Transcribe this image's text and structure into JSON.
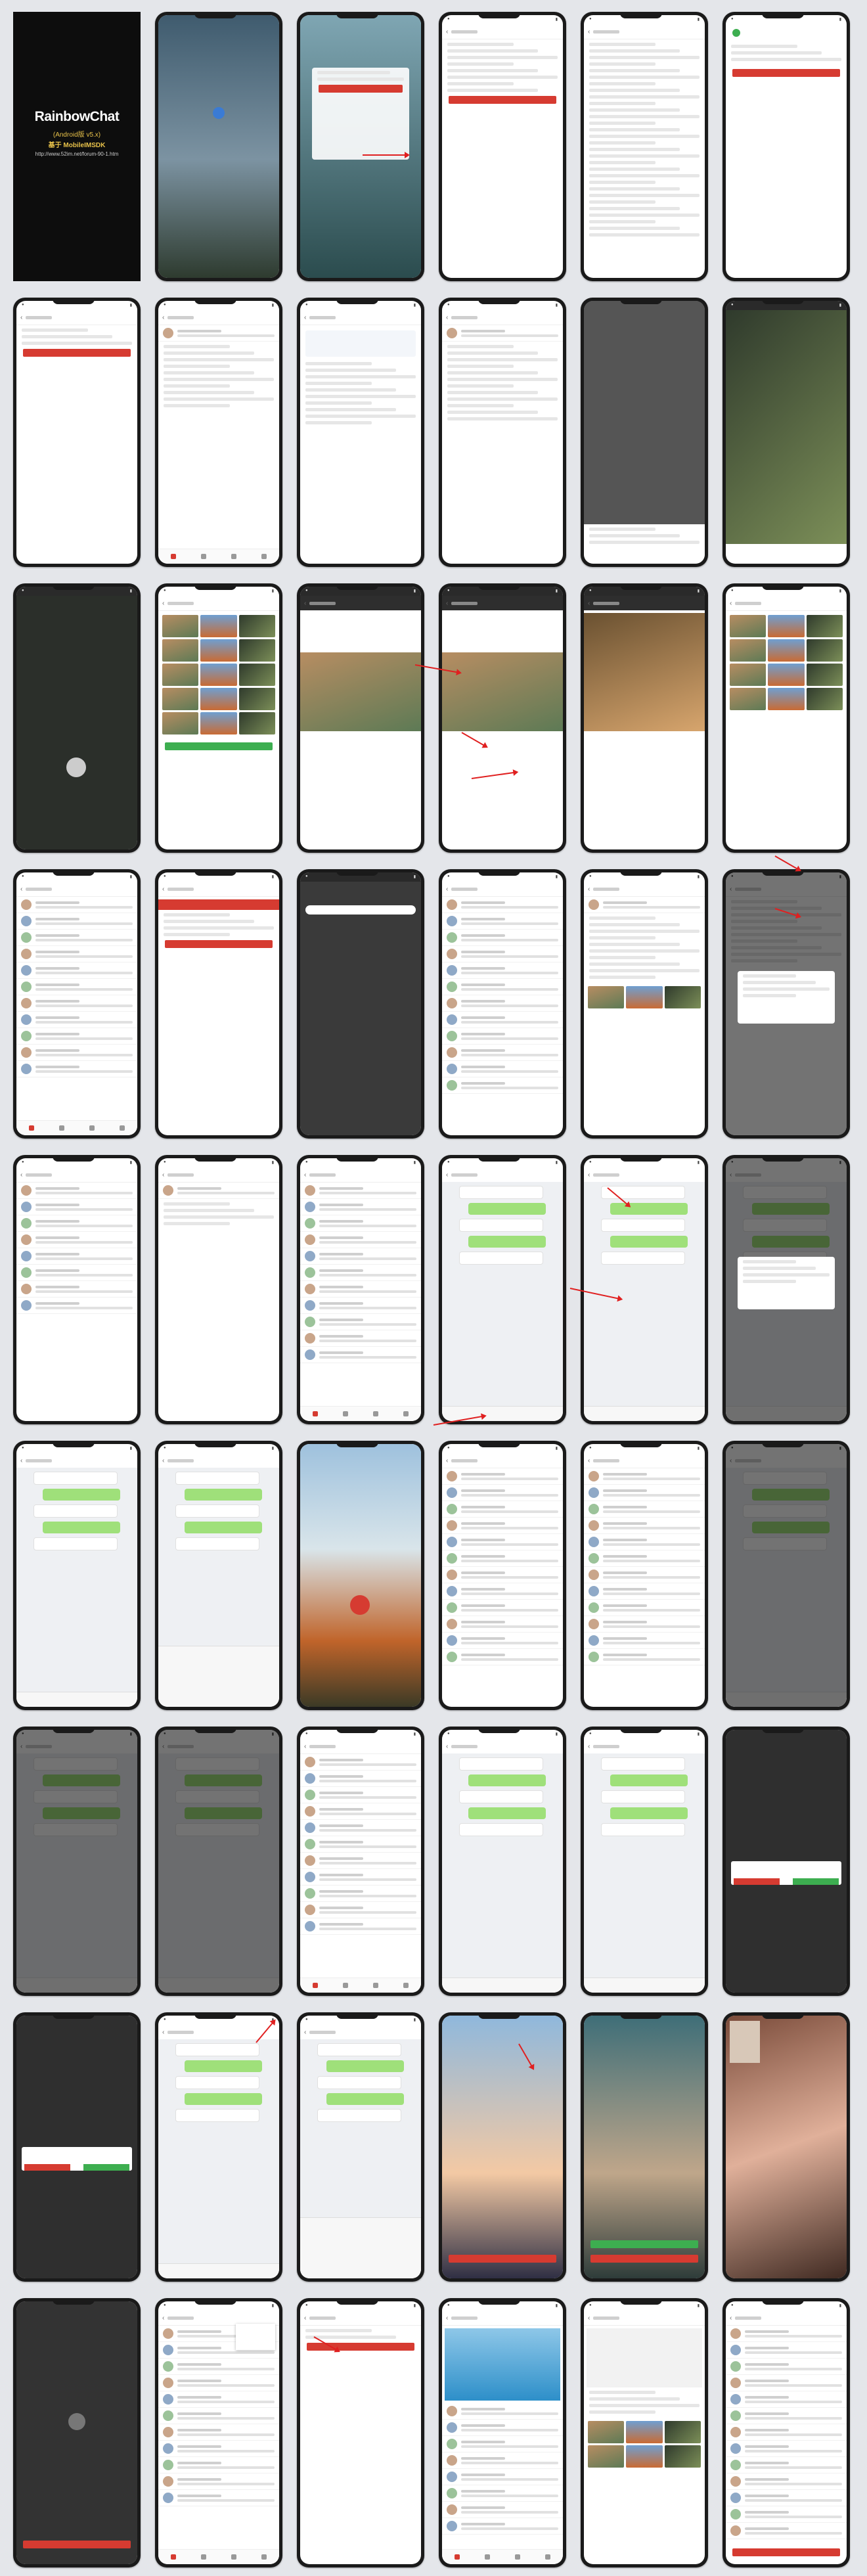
{
  "title_card": {
    "app_name": "RainbowChat",
    "edition": "(Android版 v5.x)",
    "sdk_note": "基于 MobileIMSDK",
    "url": "http://www.52im.net/forum-90-1.htm"
  },
  "screens": [
    {
      "kind": "title"
    },
    {
      "kind": "splash"
    },
    {
      "kind": "login"
    },
    {
      "kind": "register"
    },
    {
      "kind": "terms"
    },
    {
      "kind": "register-success"
    },
    {
      "kind": "forgot-password"
    },
    {
      "kind": "settings"
    },
    {
      "kind": "about"
    },
    {
      "kind": "profile-form"
    },
    {
      "kind": "avatar-picker"
    },
    {
      "kind": "crop"
    },
    {
      "kind": "camera"
    },
    {
      "kind": "album"
    },
    {
      "kind": "photo-upload"
    },
    {
      "kind": "photo-view"
    },
    {
      "kind": "portrait"
    },
    {
      "kind": "gallery"
    },
    {
      "kind": "chat-list"
    },
    {
      "kind": "find-user"
    },
    {
      "kind": "find-user-dark"
    },
    {
      "kind": "search-result"
    },
    {
      "kind": "user-profile"
    },
    {
      "kind": "add-friend-dialog"
    },
    {
      "kind": "friend-requests"
    },
    {
      "kind": "verify-request"
    },
    {
      "kind": "contacts"
    },
    {
      "kind": "chat"
    },
    {
      "kind": "chat-more"
    },
    {
      "kind": "chat-dialog"
    },
    {
      "kind": "chat-media"
    },
    {
      "kind": "chat-panel"
    },
    {
      "kind": "photo-full"
    },
    {
      "kind": "file-browser"
    },
    {
      "kind": "file-list"
    },
    {
      "kind": "chat-dark"
    },
    {
      "kind": "chat-dark2"
    },
    {
      "kind": "chat-dark3"
    },
    {
      "kind": "chat-list-arrow"
    },
    {
      "kind": "group-chat"
    },
    {
      "kind": "location"
    },
    {
      "kind": "incoming-call"
    },
    {
      "kind": "incoming-call2"
    },
    {
      "kind": "chat-voice"
    },
    {
      "kind": "chat-panel2"
    },
    {
      "kind": "video-call"
    },
    {
      "kind": "video-call2"
    },
    {
      "kind": "video-live"
    },
    {
      "kind": "call-ended"
    },
    {
      "kind": "contacts-menu"
    },
    {
      "kind": "send-gift"
    },
    {
      "kind": "shop"
    },
    {
      "kind": "product"
    },
    {
      "kind": "order-list"
    }
  ]
}
